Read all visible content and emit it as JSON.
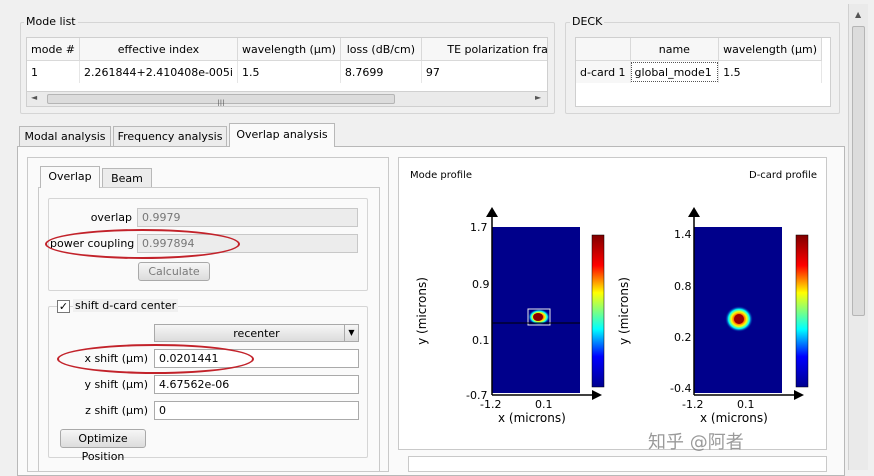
{
  "mode_list": {
    "title": "Mode list",
    "columns": [
      "mode #",
      "effective index",
      "wavelength (µm)",
      "loss (dB/cm)",
      "TE polarization fraction (Ex)"
    ],
    "rows": [
      [
        "1",
        "2.261844+2.410408e-005i",
        "1.5",
        "8.7699",
        "97"
      ]
    ],
    "scroll_left": "◄",
    "scroll_right": "►",
    "grip": "|||"
  },
  "deck": {
    "title": "DECK",
    "columns": [
      "",
      "name",
      "wavelength (µm)"
    ],
    "rows": [
      [
        "d-card 1",
        "global_mode1",
        "1.5"
      ]
    ]
  },
  "main_tabs": [
    {
      "label": "Modal analysis",
      "active": false
    },
    {
      "label": "Frequency analysis",
      "active": false
    },
    {
      "label": "Overlap analysis",
      "active": true
    }
  ],
  "sub_tabs": [
    {
      "label": "Overlap",
      "active": true
    },
    {
      "label": "Beam",
      "active": false
    }
  ],
  "overlap": {
    "overlap_label": "overlap",
    "overlap_value": "0.9979",
    "power_coupling_label": "power coupling",
    "power_coupling_value": "0.997894",
    "calculate_label": "Calculate"
  },
  "shift": {
    "checkbox_label": "shift d-card center",
    "checked": true,
    "dropdown_value": "recenter",
    "x_label": "x shift (µm)",
    "x_value": "0.0201441",
    "y_label": "y shift (µm)",
    "y_value": "4.67562e-06",
    "z_label": "z shift (µm)",
    "z_value": "0",
    "optimize_label": "Optimize Position"
  },
  "profiles": {
    "mode_title": "Mode profile",
    "dcard_title": "D-card profile",
    "mode_yticks": [
      "1.7",
      "0.9",
      "0.1",
      "-0.7"
    ],
    "dcard_yticks": [
      "1.4",
      "0.8",
      "0.2",
      "-0.4"
    ],
    "xticks": [
      "-1.2",
      "0.1"
    ],
    "xlabel": "x (microns)",
    "ylabel": "y (microns)"
  },
  "watermark": "知乎 @阿者",
  "colors": {
    "highlight_oval": "#c2222a",
    "plot_bg": "#00008b",
    "field_center": "#b00000"
  }
}
